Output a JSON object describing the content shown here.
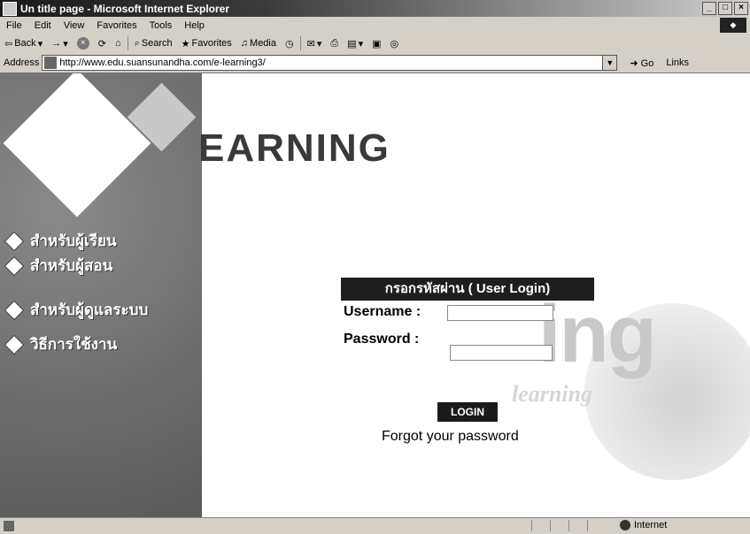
{
  "window": {
    "title": "Un title page - Microsoft Internet Explorer",
    "controls": [
      "_",
      "□",
      "×"
    ]
  },
  "menubar": {
    "items": [
      "File",
      "Edit",
      "View",
      "Favorites",
      "Tools",
      "Help"
    ]
  },
  "toolbar": {
    "back": "Back",
    "search": "Search",
    "favorites": "Favorites",
    "media": "Media"
  },
  "addressbar": {
    "label": "Address",
    "url": "http://www.edu.suansunandha.com/e-learning3/",
    "go": "Go",
    "links": "Links"
  },
  "page": {
    "heading": "EARNING",
    "nav": [
      {
        "label": "สำหรับผู้เรียน"
      },
      {
        "label": "สำหรับผู้สอน"
      },
      {
        "label": "สำหรับผู้ดูแลระบบ"
      },
      {
        "label": "วิธีการใช้งาน"
      }
    ],
    "watermark_big": "ing",
    "watermark_small": "learning",
    "login": {
      "header": "กรอกรหัสผ่าน ( User Login)",
      "username_label": "Username :",
      "password_label": "Password :",
      "username_value": "",
      "password_value": "",
      "button": "LOGIN",
      "forgot": "Forgot your password"
    }
  },
  "statusbar": {
    "zone": "Internet"
  }
}
